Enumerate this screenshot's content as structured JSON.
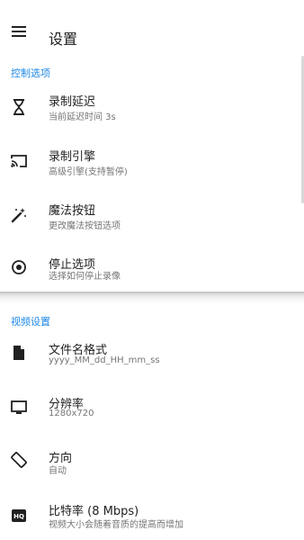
{
  "app_bar": {
    "title": "设置"
  },
  "sections": {
    "control": {
      "header": "控制选项",
      "items": [
        {
          "title": "录制延迟",
          "subtitle": "当前延迟时间 3s"
        },
        {
          "title": "录制引擎",
          "subtitle": "高级引擎(支持暂停)"
        },
        {
          "title": "魔法按钮",
          "subtitle": "更改魔法按钮选项"
        },
        {
          "title": "停止选项",
          "subtitle": "选择如何停止录像"
        }
      ]
    },
    "video": {
      "header": "视频设置",
      "items": [
        {
          "title": "文件名格式",
          "subtitle": "yyyy_MM_dd_HH_mm_ss"
        },
        {
          "title": "分辨率",
          "subtitle": "1280x720"
        },
        {
          "title": "方向",
          "subtitle": "自动"
        },
        {
          "title": "比特率 (8 Mbps)",
          "subtitle": "视频大小会随着音质的提高而增加"
        }
      ]
    }
  },
  "icons": [
    "menu-icon",
    "hourglass-icon",
    "cast-icon",
    "magic-wand-icon",
    "stop-circle-icon",
    "file-icon",
    "monitor-icon",
    "screen-rotation-icon",
    "hq-icon"
  ],
  "colors": {
    "accent": "#1e88e5",
    "icon": "#212121",
    "text_secondary": "#757575"
  }
}
